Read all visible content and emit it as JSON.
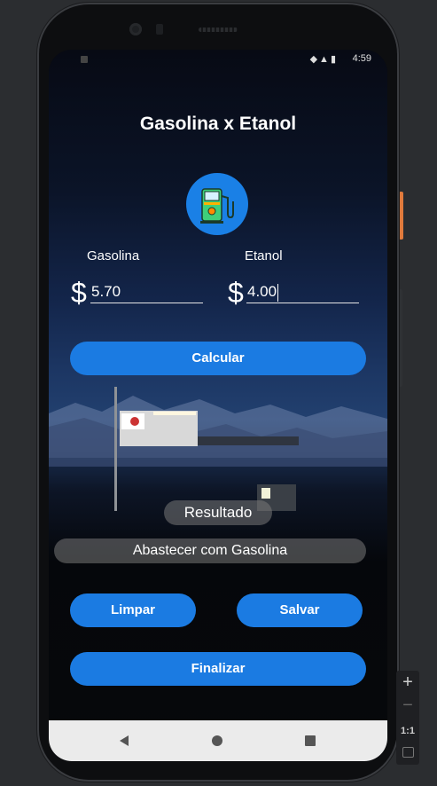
{
  "app": {
    "title": "Gasolina x Etanol"
  },
  "status_bar": {
    "time": "4:59"
  },
  "form": {
    "gasolina_label": "Gasolina",
    "etanol_label": "Etanol",
    "currency_symbol": "$",
    "gasolina_value": "5.70",
    "etanol_value": "4.00"
  },
  "buttons": {
    "calcular": "Calcular",
    "limpar": "Limpar",
    "salvar": "Salvar",
    "finalizar": "Finalizar"
  },
  "result": {
    "label": "Resultado",
    "value": "Abastecer com Gasolina"
  },
  "zoom_controls": {
    "plus": "+",
    "minus": "−",
    "ratio": "1:1"
  },
  "colors": {
    "accent": "#1b7be2",
    "pump_circle": "#1a80e6"
  }
}
